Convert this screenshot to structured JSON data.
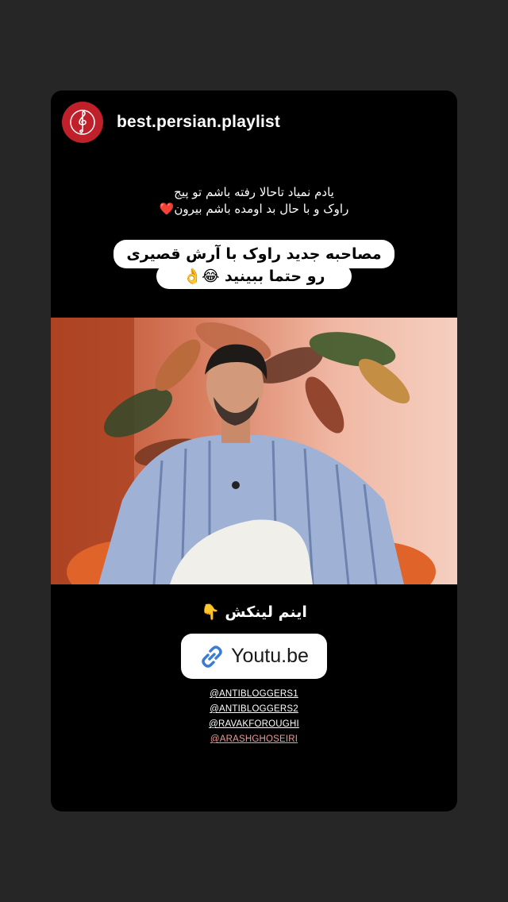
{
  "account": {
    "username": "best.persian.playlist",
    "avatar_icon": "treble-clef-icon",
    "avatar_color": "#c0202a"
  },
  "caption": {
    "line1": "یادم نمیاد تاحالا رفته باشم تو پیج",
    "line2": "راوک و با حال بد اومده باشم بیرون❤️"
  },
  "headline": {
    "line1": "مصاحبه جدید راوک با آرش قصیری",
    "line2": "رو حتما ببینید 😂👌"
  },
  "link_section": {
    "label": "اینم لینکش 👇",
    "link_icon": "link-icon",
    "link_text": "Youtu.be"
  },
  "mentions": [
    {
      "text": "@ANTIBLOGGERS1",
      "color": "#ffffff"
    },
    {
      "text": "@ANTIBLOGGERS2",
      "color": "#ffffff"
    },
    {
      "text": "@RAVAKFOROUGHI",
      "color": "#ffffff"
    },
    {
      "text": "@ARASHGHOSEIRI",
      "color": "#f29a9a"
    }
  ]
}
